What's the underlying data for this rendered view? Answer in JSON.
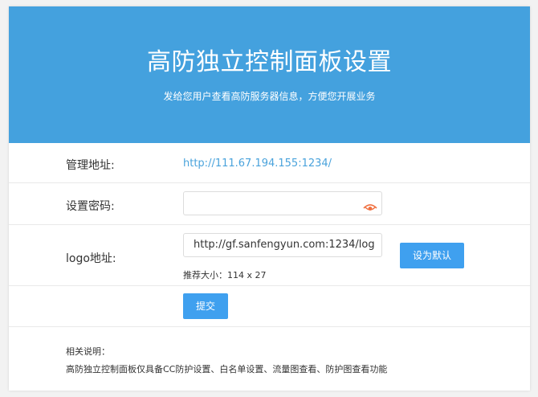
{
  "banner": {
    "title": "高防独立控制面板设置",
    "subtitle": "发给您用户查看高防服务器信息，方便您开展业务",
    "color": "#44a1de"
  },
  "form": {
    "admin_url": {
      "label": "管理地址:",
      "value": "http://111.67.194.155:1234/"
    },
    "password": {
      "label": "设置密码:",
      "value": "",
      "toggle_icon": "eye-icon"
    },
    "logo": {
      "label": "logo地址:",
      "value": "http://gf.sanfengyun.com:1234/log",
      "hint": "推荐大小：114 x 27",
      "default_button": "设为默认"
    },
    "submit_label": "提交"
  },
  "notes": {
    "title": "相关说明：",
    "text": "高防独立控制面板仅具备CC防护设置、白名单设置、流量图查看、防护图查看功能"
  },
  "colors": {
    "button": "#3fa0ef",
    "link": "#4aa3dc",
    "eye": "#f07040"
  }
}
